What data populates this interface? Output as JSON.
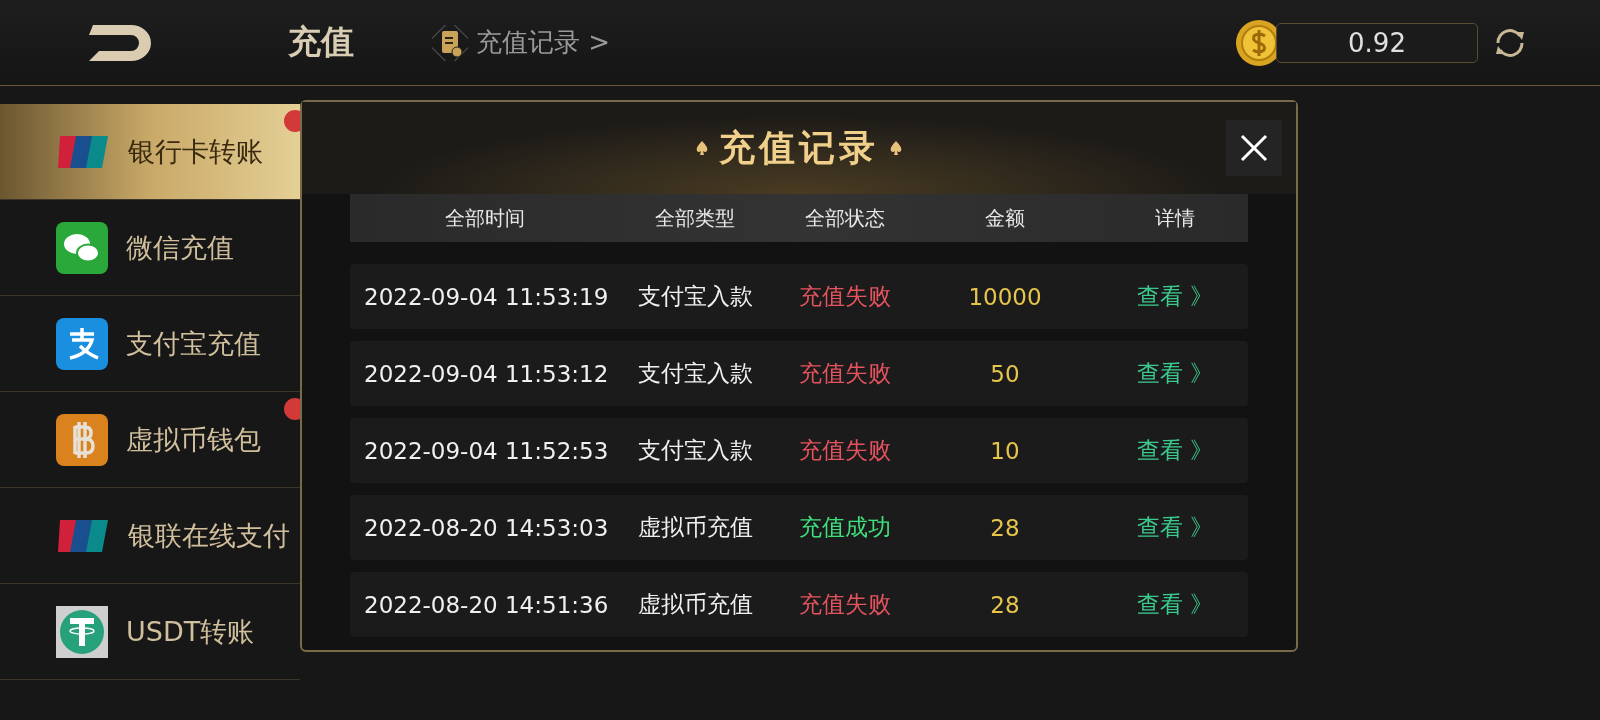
{
  "header": {
    "title": "充值",
    "records_link": "充值记录 >",
    "balance": "0.92"
  },
  "sidebar": {
    "items": [
      {
        "label": "银行卡转账",
        "kind": "unionpay",
        "selected": true,
        "badge": true
      },
      {
        "label": "微信充值",
        "kind": "wechat",
        "selected": false,
        "badge": false
      },
      {
        "label": "支付宝充值",
        "kind": "alipay",
        "selected": false,
        "badge": false
      },
      {
        "label": "虚拟币钱包",
        "kind": "bitcoin",
        "selected": false,
        "badge": true
      },
      {
        "label": "银联在线支付",
        "kind": "unionpay",
        "selected": false,
        "badge": false
      },
      {
        "label": "USDT转账",
        "kind": "tether",
        "selected": false,
        "badge": false
      }
    ]
  },
  "dialog": {
    "title": "充值记录",
    "columns": [
      "全部时间",
      "全部类型",
      "全部状态",
      "金额",
      "详情"
    ],
    "rows": [
      {
        "time": "2022-09-04 11:53:19",
        "type": "支付宝入款",
        "status": "充值失败",
        "success": false,
        "amount": "10000",
        "detail": "查看 》"
      },
      {
        "time": "2022-09-04 11:53:12",
        "type": "支付宝入款",
        "status": "充值失败",
        "success": false,
        "amount": "50",
        "detail": "查看 》"
      },
      {
        "time": "2022-09-04 11:52:53",
        "type": "支付宝入款",
        "status": "充值失败",
        "success": false,
        "amount": "10",
        "detail": "查看 》"
      },
      {
        "time": "2022-08-20 14:53:03",
        "type": "虚拟币充值",
        "status": "充值成功",
        "success": true,
        "amount": "28",
        "detail": "查看 》"
      },
      {
        "time": "2022-08-20 14:51:36",
        "type": "虚拟币充值",
        "status": "充值失败",
        "success": false,
        "amount": "28",
        "detail": "查看 》"
      }
    ]
  }
}
